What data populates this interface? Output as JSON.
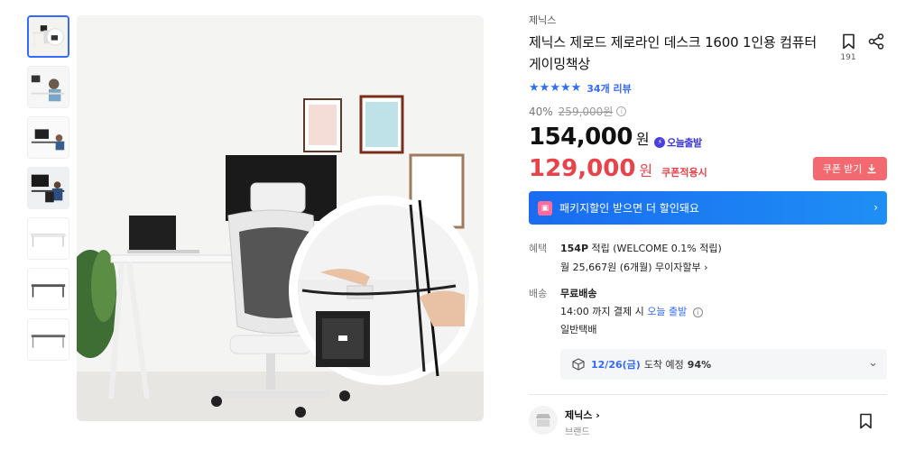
{
  "product": {
    "brand": "제닉스",
    "title": "제닉스 제로드 제로라인 데스크 1600 1인용 컴퓨터 게이밍책상",
    "bookmark_count": "191",
    "review_count": "34개 리뷰",
    "rating_stars": 5
  },
  "pricing": {
    "discount_rate": "40%",
    "original_price": "259,000원",
    "price": "154,000",
    "price_unit": "원",
    "today_badge": "오늘출발",
    "coupon_price": "129,000",
    "coupon_unit": "원",
    "coupon_label": "쿠폰적용시",
    "coupon_button": "쿠폰 받기"
  },
  "package_banner": {
    "text": "패키지할인 받으면 더 할인돼요"
  },
  "benefit": {
    "label": "혜택",
    "points": "154P",
    "points_text": "적립 (WELCOME 0.1% 적립)",
    "installment": "월 25,667원 (6개월) 무이자할부"
  },
  "shipping": {
    "label": "배송",
    "type": "무료배송",
    "cutoff_prefix": "14:00 까지 결제 시",
    "cutoff_highlight": "오늘 출발",
    "carrier": "일반택배",
    "arrival_date": "12/26(금)",
    "arrival_text": "도착 예정",
    "arrival_rate": "94%"
  },
  "brand_section": {
    "name": "제닉스",
    "sub": "브랜드"
  },
  "colors": {
    "accent_blue": "#346aff",
    "price_red": "#e8424a",
    "coupon_btn": "#f26a6f"
  }
}
